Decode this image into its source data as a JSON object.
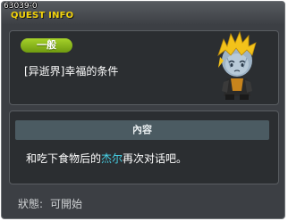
{
  "quest_id": "63039-0",
  "window_title": "QUEST INFO",
  "quest": {
    "category": "一般",
    "name": "[异逝界]幸福的条件"
  },
  "content": {
    "header": "內容",
    "text_before": "和吃下食物后的",
    "npc_name": "杰尔",
    "text_after": "再次对话吧。",
    "npc_color": "#48d3e8"
  },
  "status": {
    "label": "狀態:",
    "value": "可開始"
  },
  "colors": {
    "title": "#f2d20c",
    "badge": "#8bb81d",
    "window_bg": "#3c3f44"
  },
  "icons": {
    "character": "sad-yellow-haired-npc-sprite"
  }
}
